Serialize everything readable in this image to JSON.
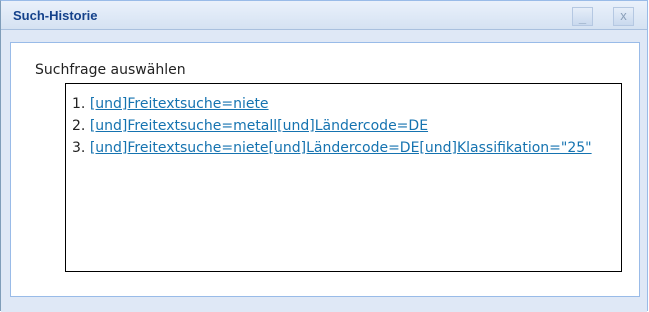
{
  "window": {
    "title": "Such-Historie",
    "minimize_glyph": "_",
    "close_glyph": "x"
  },
  "content": {
    "label": "Suchfrage auswählen",
    "items": [
      {
        "index": "1.",
        "query": "[und]Freitextsuche=niete"
      },
      {
        "index": "2.",
        "query": "[und]Freitextsuche=metall[und]Ländercode=DE"
      },
      {
        "index": "3.",
        "query": "[und]Freitextsuche=niete[und]Ländercode=DE[und]Klassifikation=\"25\""
      }
    ]
  },
  "colors": {
    "title_text": "#15428b",
    "link": "#1573b0",
    "panel_background": "#dfe8f6",
    "border": "#99bbe8"
  }
}
